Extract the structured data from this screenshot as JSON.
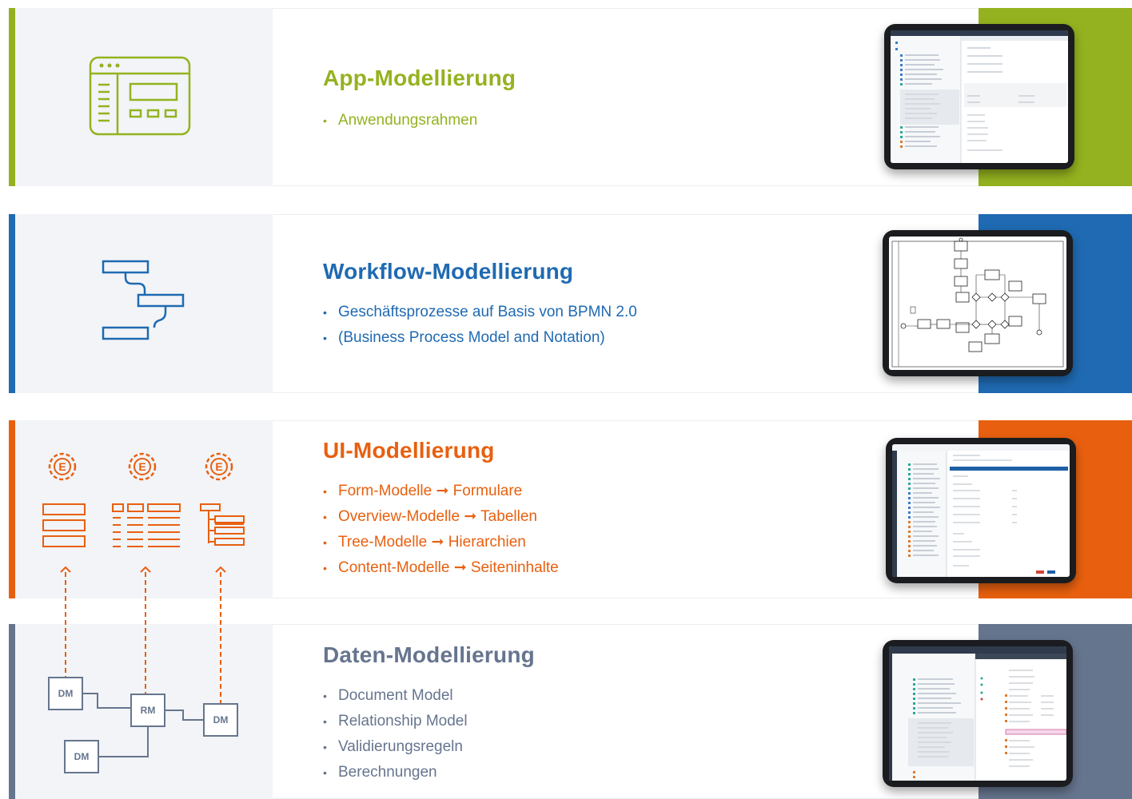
{
  "colors": {
    "app": "#94b21f",
    "workflow": "#1f6ab2",
    "ui": "#e8600f",
    "data": "#66758e"
  },
  "sections": [
    {
      "id": "app",
      "title": "App-Modellierung",
      "icon": "app-window-icon",
      "bullets": [
        "Anwendungsrahmen"
      ]
    },
    {
      "id": "workflow",
      "title": "Workflow-Modellierung",
      "icon": "workflow-steps-icon",
      "bullets": [
        "Geschäftsprozesse auf Basis von BPMN 2.0",
        "(Business Process Model and Notation)"
      ]
    },
    {
      "id": "ui",
      "title": "UI-Modellierung",
      "icon": "ui-gears-icon",
      "bullets": [
        "Form-Modelle ➞ Formulare",
        "Overview-Modelle ➞ Tabellen",
        "Tree-Modelle ➞ Hierarchien",
        "Content-Modelle ➞ Seiteninhalte"
      ],
      "gear_label": "E"
    },
    {
      "id": "data",
      "title": "Daten-Modellierung",
      "icon": "data-model-icon",
      "bullets": [
        "Document Model",
        "Relationship Model",
        "Validierungsregeln",
        "Berechnungen"
      ],
      "diagram_labels": {
        "dm": "DM",
        "rm": "RM"
      }
    }
  ]
}
